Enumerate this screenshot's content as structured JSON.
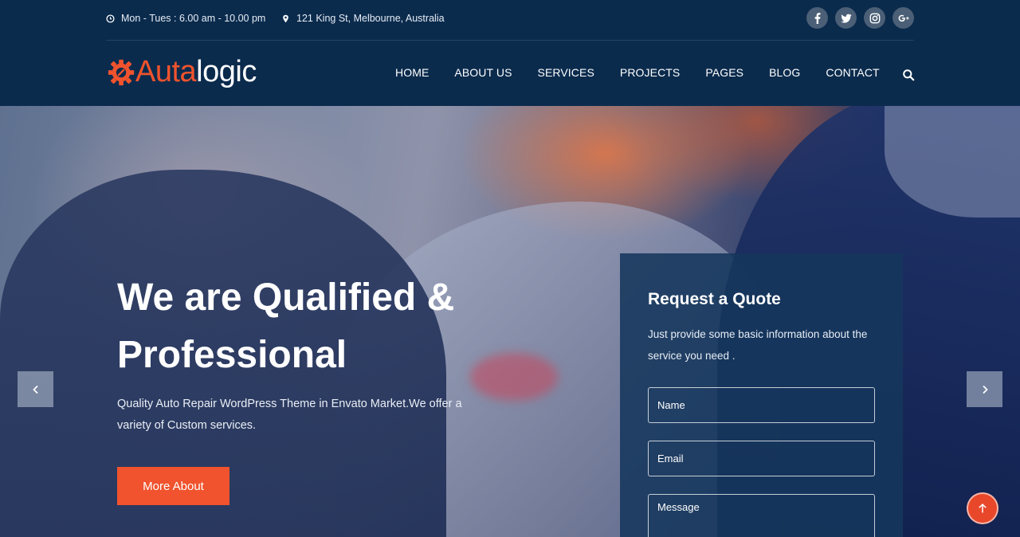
{
  "topbar": {
    "hours": "Mon - Tues : 6.00 am - 10.00 pm",
    "address": "121 King St, Melbourne, Australia",
    "socials": [
      "facebook-icon",
      "twitter-icon",
      "instagram-icon",
      "google-plus-icon"
    ]
  },
  "logo": {
    "part1": "Auta",
    "part2": "logic"
  },
  "nav": {
    "items": [
      {
        "label": "HOME"
      },
      {
        "label": "ABOUT US"
      },
      {
        "label": "SERVICES"
      },
      {
        "label": "PROJECTS"
      },
      {
        "label": "PAGES"
      },
      {
        "label": "BLOG"
      },
      {
        "label": "CONTACT"
      }
    ]
  },
  "hero": {
    "title_line1": "We are Qualified &",
    "title_line2": "Professional",
    "subtitle": "Quality Auto Repair WordPress Theme in Envato Market.We offer a variety of Custom services.",
    "button": "More About"
  },
  "quote": {
    "title": "Request a Quote",
    "description": "Just provide some basic information about the service you need .",
    "name_placeholder": "Name",
    "email_placeholder": "Email",
    "message_placeholder": "Message"
  },
  "colors": {
    "accent": "#f0532d",
    "header_bg": "#0b2b4d",
    "panel_bg": "#16375c"
  }
}
